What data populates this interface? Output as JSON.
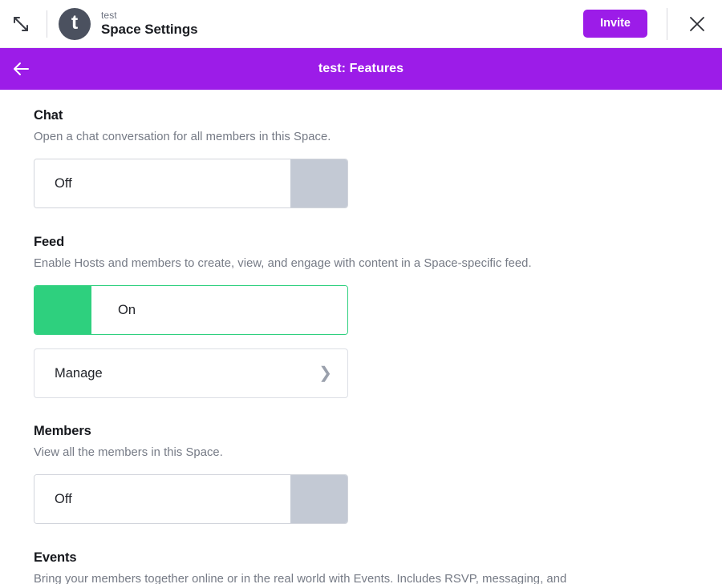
{
  "topbar": {
    "expand_icon": "expand-diagonal-icon",
    "avatar_letter": "t",
    "subtitle": "test",
    "title": "Space Settings",
    "invite_label": "Invite",
    "close_icon": "close-x-icon"
  },
  "banner": {
    "back_icon": "arrow-left-icon",
    "title": "test: Features",
    "color": "#9c1ce8"
  },
  "sections": [
    {
      "key": "chat",
      "title": "Chat",
      "description": "Open a chat conversation for all members in this Space.",
      "toggle_state": "off",
      "toggle_label": "Off"
    },
    {
      "key": "feed",
      "title": "Feed",
      "description": "Enable Hosts and members to create, view, and engage with content in a Space-specific feed.",
      "toggle_state": "on",
      "toggle_label": "On",
      "manage_label": "Manage",
      "manage_chevron": "chevron-right-icon"
    },
    {
      "key": "members",
      "title": "Members",
      "description": "View all the members in this Space.",
      "toggle_state": "off",
      "toggle_label": "Off"
    },
    {
      "key": "events",
      "title": "Events",
      "description": "Bring your members together online or in the real world with Events. Includes RSVP, messaging, and"
    }
  ],
  "colors": {
    "accent_purple": "#9c1ce8",
    "toggle_on_green": "#2ed07e",
    "toggle_off_gray": "#c3c9d4",
    "avatar_bg": "#4b515f"
  }
}
